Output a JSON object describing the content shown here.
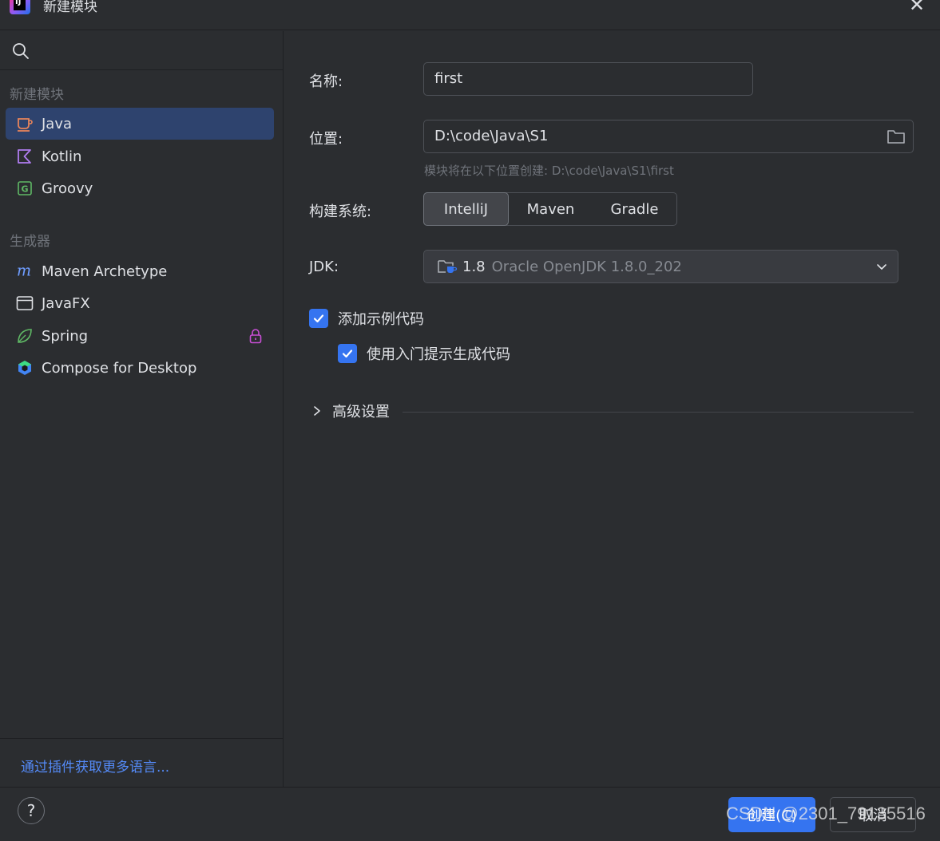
{
  "window": {
    "title": "新建模块",
    "close": "✕"
  },
  "sidebar": {
    "new_module_group": "新建模块",
    "generators_group": "生成器",
    "items": [
      {
        "label": "Java",
        "icon": "java-cup-icon"
      },
      {
        "label": "Kotlin",
        "icon": "kotlin-icon"
      },
      {
        "label": "Groovy",
        "icon": "groovy-icon"
      }
    ],
    "generators": [
      {
        "label": "Maven Archetype",
        "icon": "maven-icon"
      },
      {
        "label": "JavaFX",
        "icon": "window-icon"
      },
      {
        "label": "Spring",
        "icon": "spring-leaf-icon",
        "locked": true
      },
      {
        "label": "Compose for Desktop",
        "icon": "compose-icon"
      }
    ],
    "plugins_link": "通过插件获取更多语言..."
  },
  "form": {
    "name_label": "名称:",
    "name_value": "first",
    "location_label": "位置:",
    "location_value": "D:\\code\\Java\\S1",
    "location_hint": "模块将在以下位置创建: D:\\code\\Java\\S1\\first",
    "build_label": "构建系统:",
    "build_options": [
      "IntelliJ",
      "Maven",
      "Gradle"
    ],
    "build_selected": "IntelliJ",
    "jdk_label": "JDK:",
    "jdk_version": "1.8",
    "jdk_name": "Oracle OpenJDK 1.8.0_202",
    "add_sample_code": "添加示例代码",
    "onboarding_tips": "使用入门提示生成代码",
    "advanced_settings": "高级设置"
  },
  "footer": {
    "help": "?",
    "create": "创建(C)",
    "cancel": "取消",
    "watermark": "CSDN @2301_79135516"
  },
  "colors": {
    "background": "#2b2d30",
    "selected": "#2e436e",
    "accent": "#3574f0",
    "link": "#548af7"
  }
}
